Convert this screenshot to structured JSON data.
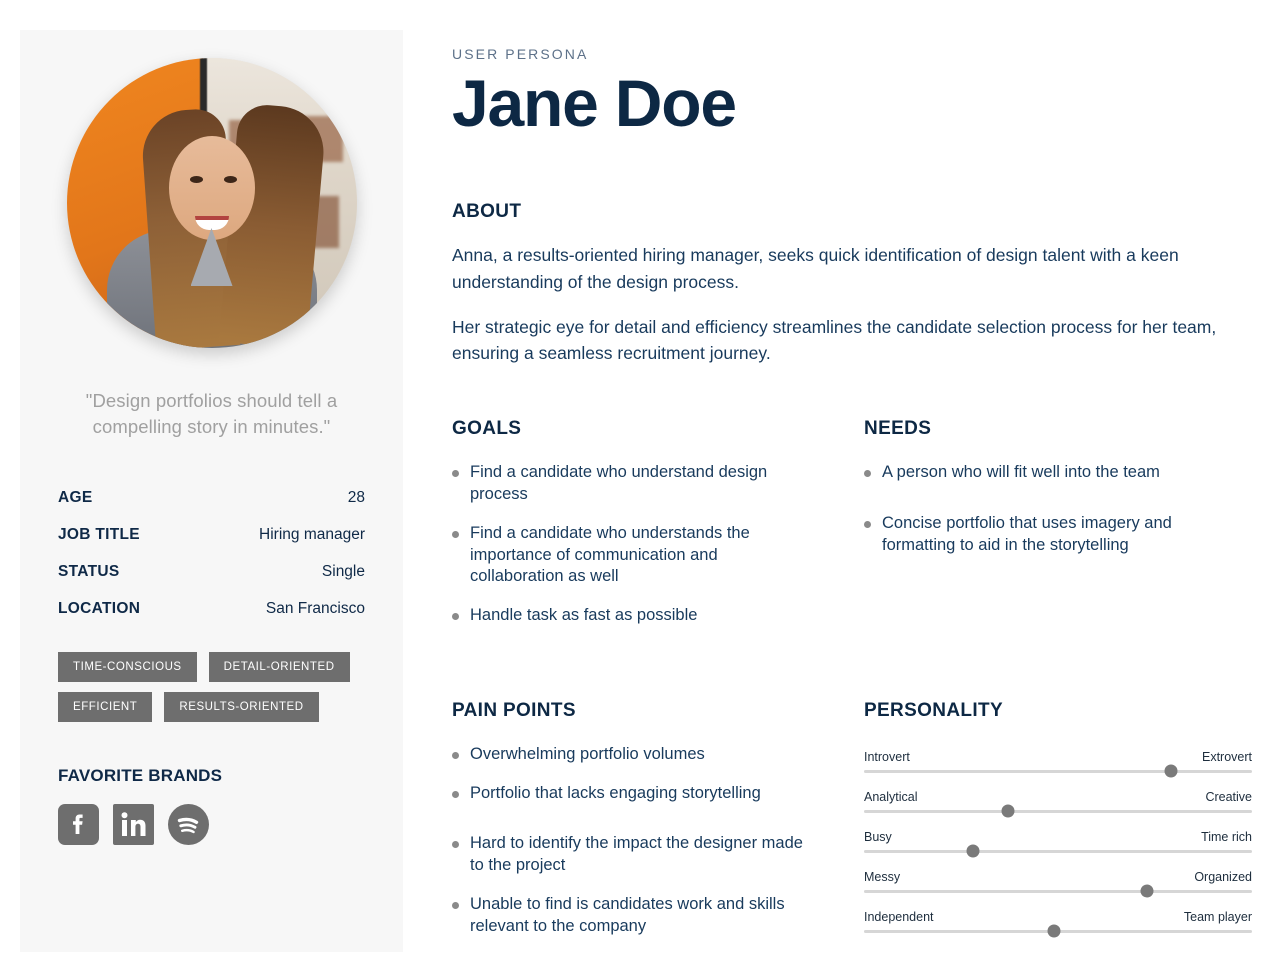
{
  "sidebar": {
    "avatar_alt": "portrait-photo-of-persona",
    "quote": "\"Design portfolios should tell a compelling story in minutes.\"",
    "attributes": [
      {
        "key": "AGE",
        "value": "28"
      },
      {
        "key": "JOB TITLE",
        "value": "Hiring manager"
      },
      {
        "key": "STATUS",
        "value": "Single"
      },
      {
        "key": "LOCATION",
        "value": "San Francisco"
      }
    ],
    "tags": [
      "TIME-CONSCIOUS",
      "DETAIL-ORIENTED",
      "EFFICIENT",
      "RESULTS-ORIENTED"
    ],
    "brands_title": "FAVORITE BRANDS",
    "brands": [
      {
        "name": "facebook-icon"
      },
      {
        "name": "linkedin-icon"
      },
      {
        "name": "spotify-icon"
      }
    ]
  },
  "header": {
    "eyebrow": "USER PERSONA",
    "name": "Jane Doe"
  },
  "about": {
    "title": "ABOUT",
    "paragraphs": [
      "Anna, a results-oriented hiring manager, seeks quick identification of design talent with a keen understanding of the design process.",
      "Her strategic eye for detail and efficiency streamlines the candidate selection process for her team, ensuring a seamless recruitment journey."
    ]
  },
  "goals": {
    "title": "GOALS",
    "items": [
      "Find a candidate who understand design process",
      "Find a candidate who understands the importance of communication and collaboration as well",
      "Handle task as fast as possible"
    ]
  },
  "needs": {
    "title": "NEEDS",
    "items": [
      "A person who will fit well into the team",
      "Concise portfolio that uses imagery and formatting to aid in the storytelling"
    ]
  },
  "pain_points": {
    "title": "PAIN POINTS",
    "items": [
      "Overwhelming portfolio volumes",
      "Portfolio that lacks engaging storytelling",
      "Hard to identify the impact the designer made to the project",
      "Unable to find is candidates work and skills relevant to the company"
    ]
  },
  "personality": {
    "title": "PERSONALITY",
    "sliders": [
      {
        "left": "Introvert",
        "right": "Extrovert",
        "value": 79
      },
      {
        "left": "Analytical",
        "right": "Creative",
        "value": 37
      },
      {
        "left": "Busy",
        "right": "Time rich",
        "value": 28
      },
      {
        "left": "Messy",
        "right": "Organized",
        "value": 73
      },
      {
        "left": "Independent",
        "right": "Team player",
        "value": 49
      }
    ]
  },
  "colors": {
    "navy": "#0d2844",
    "body_text": "#183a5c",
    "muted": "#5d7189",
    "quote_gray": "#a0a0a0",
    "tag_gray": "#6e6e6e",
    "knob_gray": "#7a7a7a",
    "card_bg": "#f7f7f7",
    "accent_orange": "#e2761a"
  }
}
